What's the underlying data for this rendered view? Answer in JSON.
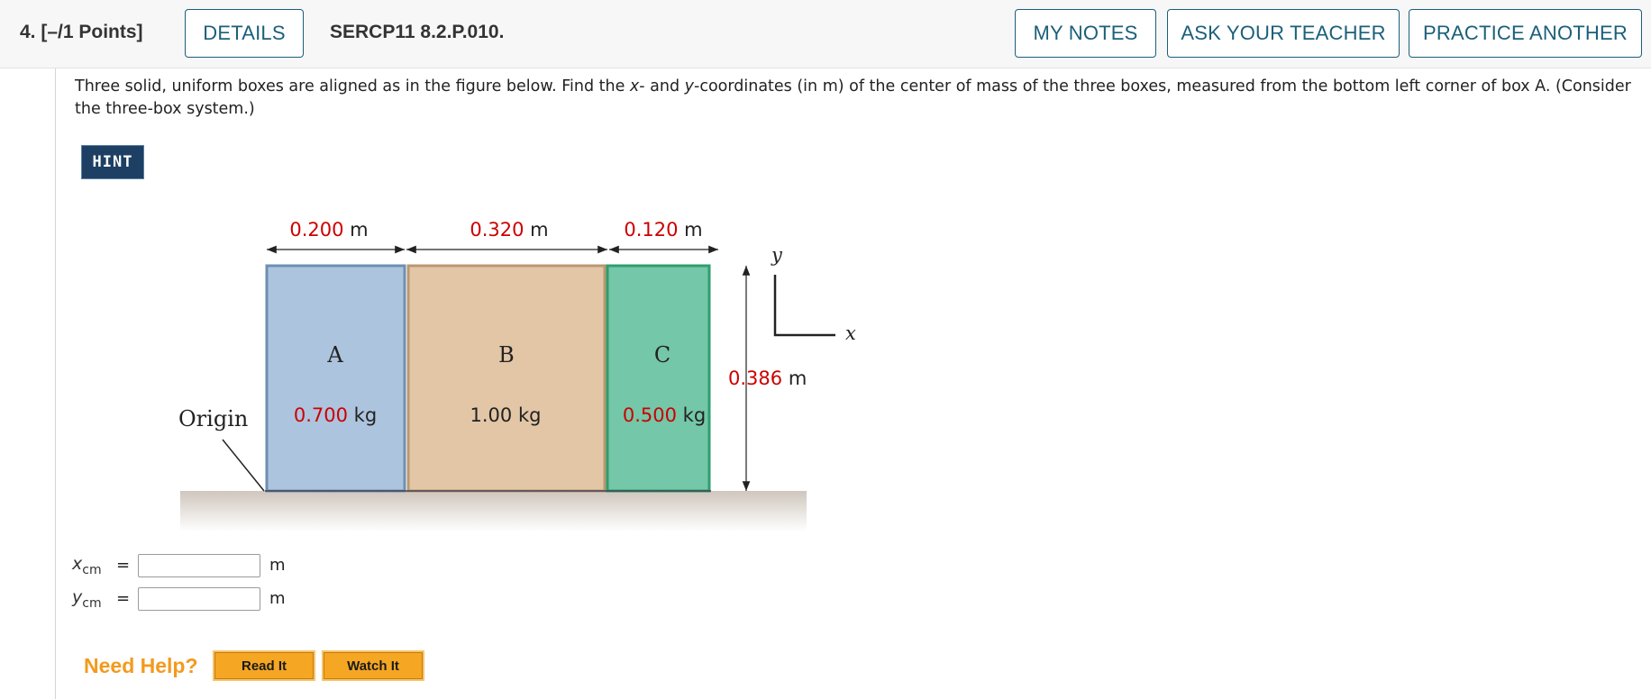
{
  "header": {
    "question_number": "4.",
    "points": "[–/1 Points]",
    "details_label": "DETAILS",
    "problem_code": "SERCP11 8.2.P.010.",
    "my_notes_label": "MY NOTES",
    "ask_teacher_label": "ASK YOUR TEACHER",
    "practice_another_label": "PRACTICE ANOTHER"
  },
  "question": {
    "part1": "Three solid, uniform boxes are aligned as in the figure below. Find the ",
    "var_x": "x",
    "part2": "- and ",
    "var_y": "y",
    "part3": "-coordinates (in m) of the center of mass of the three boxes, measured from the bottom left corner of box A. (Consider the three-box system.)"
  },
  "hint_label": "HINT",
  "figure": {
    "widths": [
      {
        "value": "0.200",
        "unit": "m"
      },
      {
        "value": "0.320",
        "unit": "m"
      },
      {
        "value": "0.120",
        "unit": "m"
      }
    ],
    "height": {
      "value": "0.386",
      "unit": "m"
    },
    "boxes": [
      {
        "name": "A",
        "mass_value": "0.700",
        "mass_unit": "kg",
        "color": "#adc4de"
      },
      {
        "name": "B",
        "mass_value": "1.00",
        "mass_unit": "kg",
        "color": "#e2c6a6"
      },
      {
        "name": "C",
        "mass_value": "0.500",
        "mass_unit": "kg",
        "color": "#74c7a8"
      }
    ],
    "origin_label": "Origin",
    "axis_x_label": "x",
    "axis_y_label": "y",
    "given_value_color": "#cc0000"
  },
  "answers": [
    {
      "var": "x",
      "sub": "cm",
      "eq": "=",
      "value": "",
      "unit": "m"
    },
    {
      "var": "y",
      "sub": "cm",
      "eq": "=",
      "value": "",
      "unit": "m"
    }
  ],
  "help": {
    "need_help": "Need Help?",
    "read_it": "Read It",
    "watch_it": "Watch It"
  }
}
